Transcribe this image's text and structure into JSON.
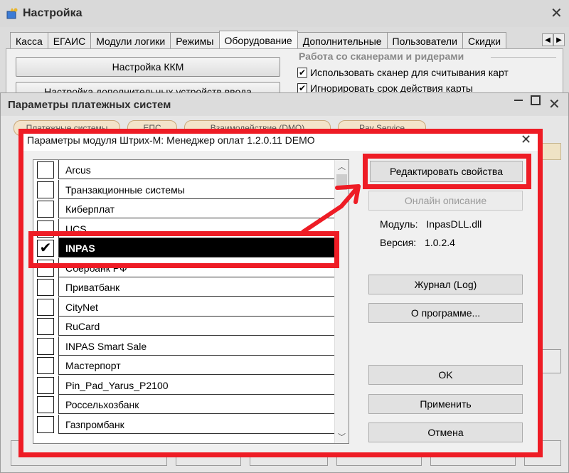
{
  "main_window": {
    "title": "Настройка",
    "tabs": [
      "Касса",
      "ЕГАИС",
      "Модули логики",
      "Режимы",
      "Оборудование",
      "Дополнительные",
      "Пользователи",
      "Скидки"
    ],
    "active_tab_index": 4,
    "buttons": [
      "Настройка ККМ",
      "Настройка дополнительных устройств ввода"
    ],
    "scanner_group": {
      "title": "Работа со сканерами и ридерами",
      "options": [
        {
          "label": "Использовать сканер для считывания карт",
          "checked": true
        },
        {
          "label": "Игнорировать срок действия карты",
          "checked": true
        }
      ]
    }
  },
  "payment_dialog": {
    "title": "Параметры платежных систем",
    "tab_pills": [
      "Платежные системы",
      "ЕПС",
      "Взаимодействие (DMO)",
      "Pay Service"
    ]
  },
  "module_dialog": {
    "title": "Параметры модуля Штрих-М: Менеджер оплат 1.2.0.11 DEMO",
    "close_glyph": "✕",
    "check_glyph": "✔",
    "systems": [
      {
        "name": "Arcus",
        "checked": false
      },
      {
        "name": "Транзакционные системы",
        "checked": false
      },
      {
        "name": "Киберплат",
        "checked": false
      },
      {
        "name": "UCS",
        "checked": false
      },
      {
        "name": "INPAS",
        "checked": true,
        "selected": true
      },
      {
        "name": "Сбербанк РФ",
        "checked": false
      },
      {
        "name": "Приватбанк",
        "checked": false
      },
      {
        "name": "CityNet",
        "checked": false
      },
      {
        "name": "RuCard",
        "checked": false
      },
      {
        "name": "INPAS Smart Sale",
        "checked": false
      },
      {
        "name": "Мастерпорт",
        "checked": false
      },
      {
        "name": "Pin_Pad_Yarus_P2100",
        "checked": false
      },
      {
        "name": "Россельхозбанк",
        "checked": false
      },
      {
        "name": "Газпромбанк",
        "checked": false
      }
    ],
    "buttons": {
      "edit_properties": "Редактировать свойства",
      "online_description": "Онлайн описание",
      "journal": "Журнал (Log)",
      "about": "О программе...",
      "ok": "OK",
      "apply": "Применить",
      "cancel": "Отмена"
    },
    "module_info": {
      "module_label": "Модуль:",
      "module_value": "InpasDLL.dll",
      "version_label": "Версия:",
      "version_value": "1.0.2.4"
    }
  },
  "annotation_color": "#ee1c25"
}
